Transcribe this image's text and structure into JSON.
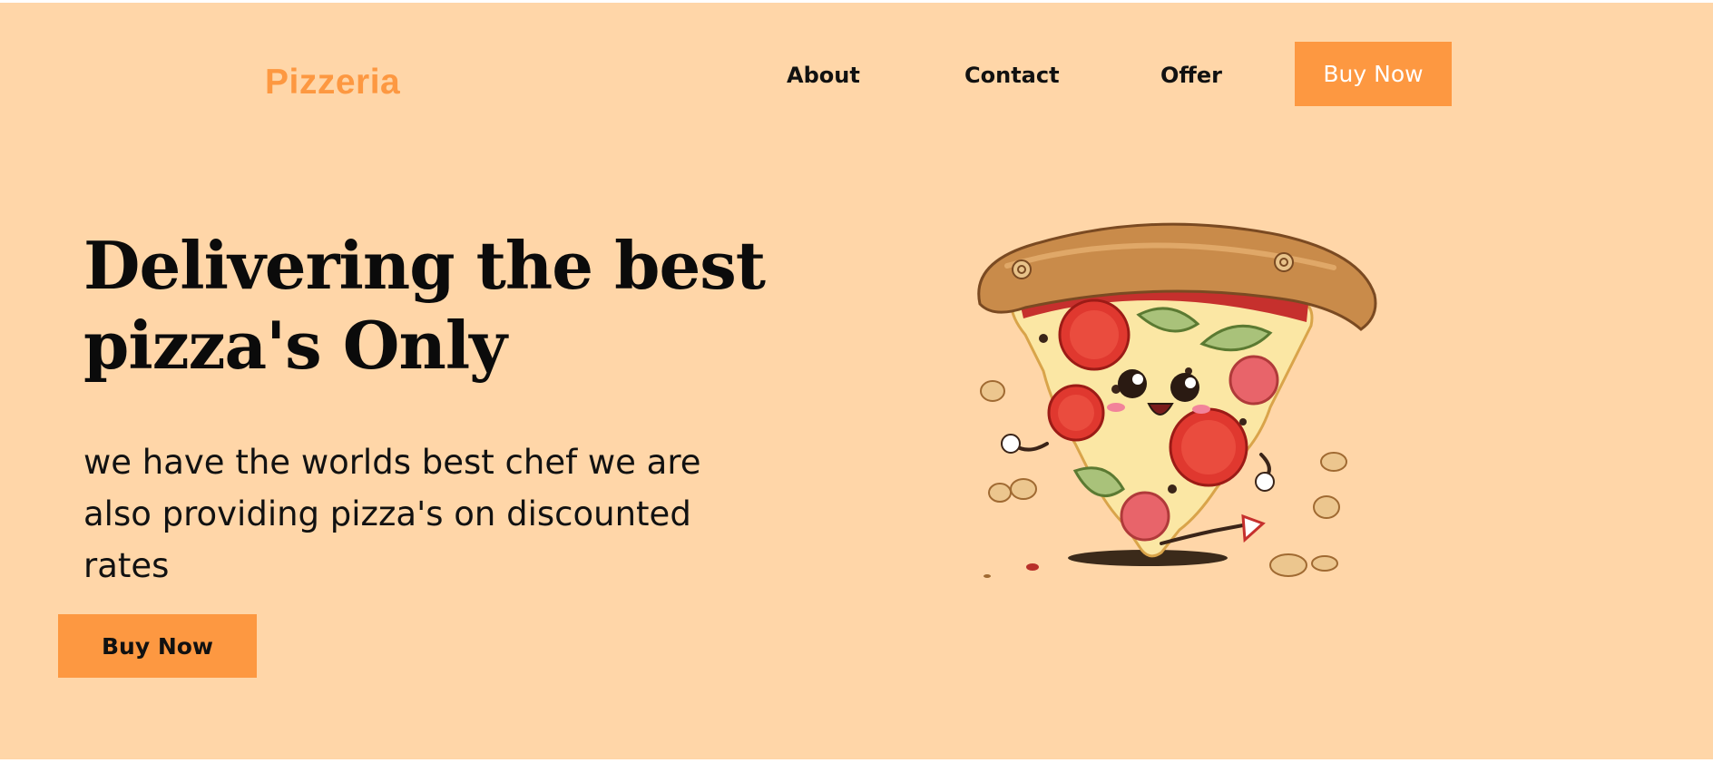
{
  "brand": {
    "name": "Pizzeria",
    "color": "#fd9841"
  },
  "nav": {
    "links": [
      "About",
      "Contact",
      "Offer"
    ],
    "cta_label": "Buy Now"
  },
  "hero": {
    "title": "Delivering the best pizza's Only",
    "description": "we have the worlds best chef we are also providing pizza's on discounted rates",
    "cta_label": "Buy Now",
    "illustration": "pizza-slice-mascot"
  },
  "colors": {
    "background": "#ffd6a8",
    "accent": "#fd9841",
    "text": "#111111"
  }
}
